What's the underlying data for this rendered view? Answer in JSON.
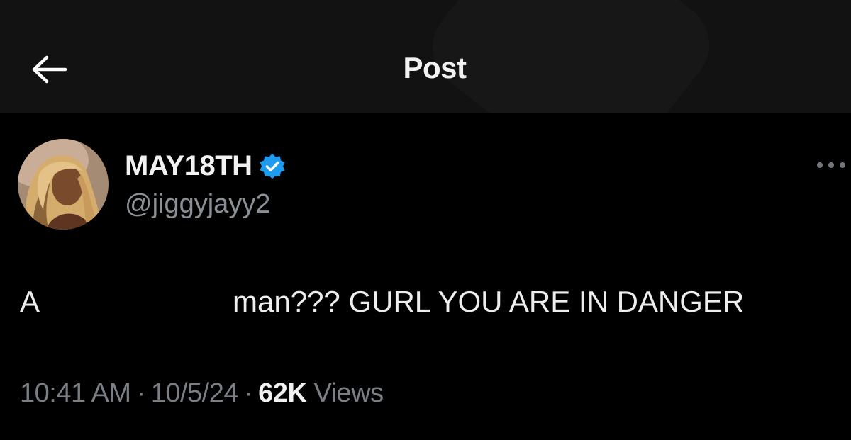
{
  "header": {
    "title": "Post",
    "back_icon": "arrow-left-icon"
  },
  "post": {
    "author": {
      "display_name": "MAY18TH",
      "handle": "@jiggyjayy2",
      "verified": true,
      "verified_color": "#1d9bf0"
    },
    "more_icon": "more-horizontal-icon",
    "text_before": "A",
    "text_after": "man??? GURL YOU ARE IN DANGER",
    "time": "10:41 AM",
    "date": "10/5/24",
    "separator": "·",
    "views_count": "62K",
    "views_label": "Views"
  },
  "colors": {
    "background": "#000000",
    "header_bg": "#121212",
    "primary_text": "#e7e9ea",
    "secondary_text": "#7a7f85",
    "accent": "#1d9bf0"
  }
}
